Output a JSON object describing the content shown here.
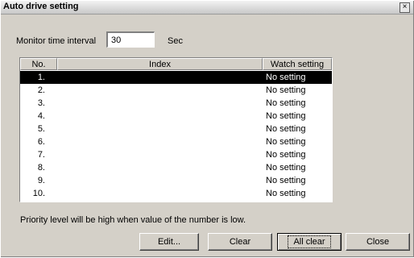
{
  "window": {
    "title": "Auto drive setting",
    "close_glyph": "×"
  },
  "monitor": {
    "label": "Monitor time interval",
    "value": "30",
    "unit": "Sec"
  },
  "table": {
    "columns": {
      "no": "No.",
      "index": "Index",
      "watch": "Watch setting"
    },
    "rows": [
      {
        "no": "1.",
        "index": "",
        "watch": "No setting"
      },
      {
        "no": "2.",
        "index": "",
        "watch": "No setting"
      },
      {
        "no": "3.",
        "index": "",
        "watch": "No setting"
      },
      {
        "no": "4.",
        "index": "",
        "watch": "No setting"
      },
      {
        "no": "5.",
        "index": "",
        "watch": "No setting"
      },
      {
        "no": "6.",
        "index": "",
        "watch": "No setting"
      },
      {
        "no": "7.",
        "index": "",
        "watch": "No setting"
      },
      {
        "no": "8.",
        "index": "",
        "watch": "No setting"
      },
      {
        "no": "9.",
        "index": "",
        "watch": "No setting"
      },
      {
        "no": "10.",
        "index": "",
        "watch": "No setting"
      }
    ]
  },
  "note": "Priority level will be high when value of the number is low.",
  "buttons": {
    "edit": "Edit...",
    "clear": "Clear",
    "all_clear": "All clear",
    "close": "Close"
  }
}
